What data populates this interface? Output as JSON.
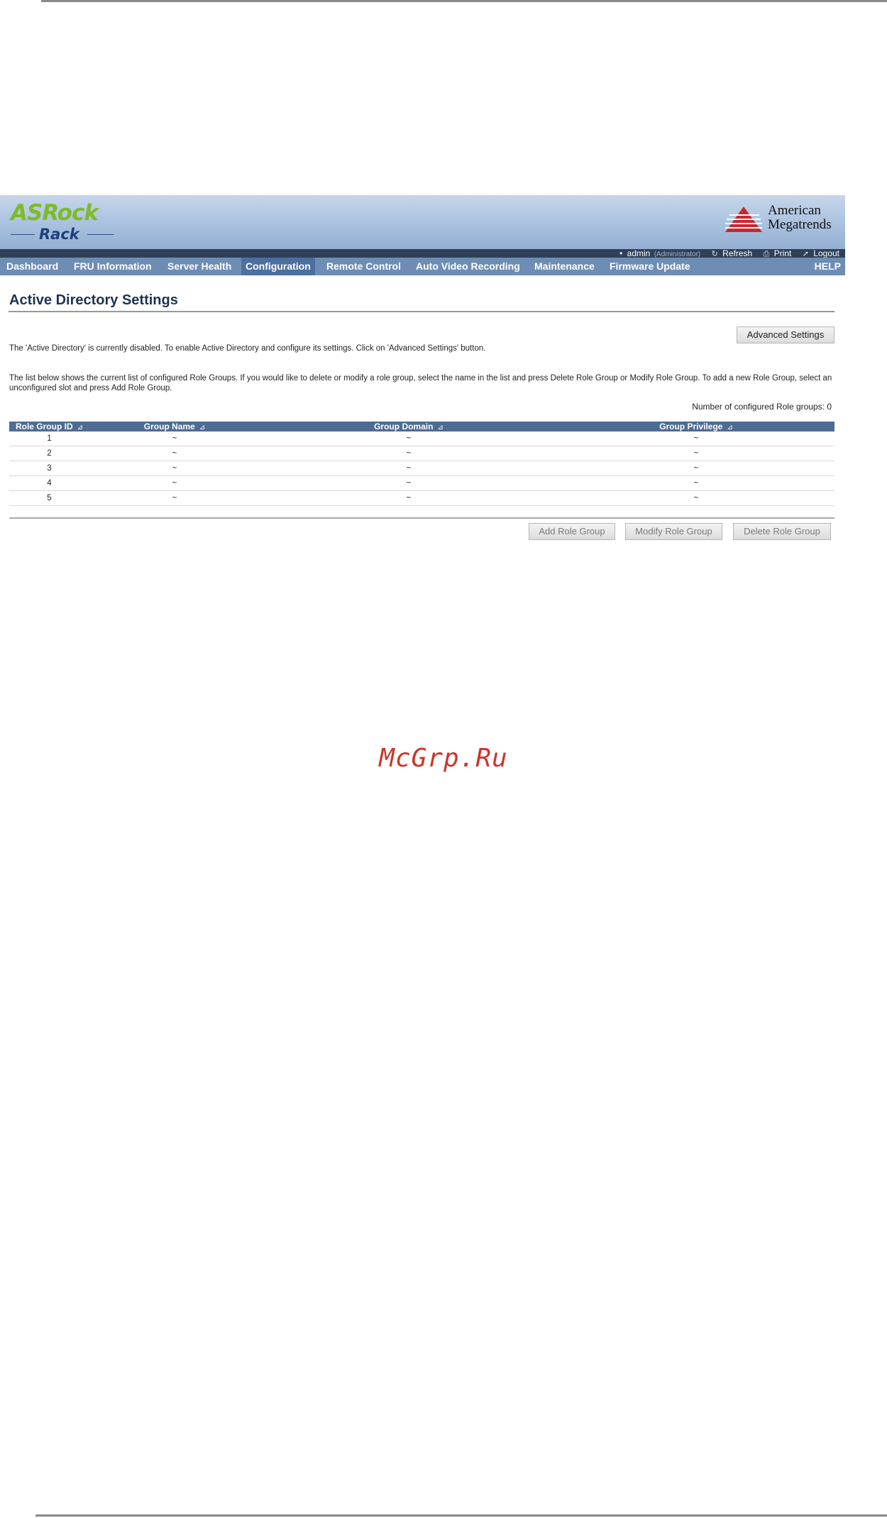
{
  "brand": {
    "logo_top": "ASRock",
    "logo_bottom": "Rack",
    "vendor_line1": "American",
    "vendor_line2": "Megatrends"
  },
  "user_bar": {
    "user": "admin",
    "role": "(Administrator)",
    "refresh": "Refresh",
    "print": "Print",
    "logout": "Logout"
  },
  "nav": {
    "items": [
      {
        "label": "Dashboard"
      },
      {
        "label": "FRU Information"
      },
      {
        "label": "Server Health"
      },
      {
        "label": "Configuration",
        "active": true
      },
      {
        "label": "Remote Control"
      },
      {
        "label": "Auto Video Recording"
      },
      {
        "label": "Maintenance"
      },
      {
        "label": "Firmware Update"
      }
    ],
    "help": "HELP"
  },
  "page": {
    "title": "Active Directory Settings",
    "advanced_button": "Advanced Settings",
    "status_text": "The 'Active Directory' is currently disabled. To enable Active Directory and configure its settings. Click on 'Advanced Settings' button.",
    "info_text": "The list below shows the current list of configured Role Groups. If you would like to delete or modify a role group, select the name in the list and press Delete Role Group or Modify Role Group. To add a new Role Group, select an unconfigured slot and press Add Role Group.",
    "count_text": "Number of configured Role groups: 0"
  },
  "table": {
    "columns": [
      "Role Group ID",
      "Group Name",
      "Group Domain",
      "Group Privilege"
    ],
    "rows": [
      [
        "1",
        "~",
        "~",
        "~"
      ],
      [
        "2",
        "~",
        "~",
        "~"
      ],
      [
        "3",
        "~",
        "~",
        "~"
      ],
      [
        "4",
        "~",
        "~",
        "~"
      ],
      [
        "5",
        "~",
        "~",
        "~"
      ]
    ]
  },
  "actions": {
    "add": "Add Role Group",
    "modify": "Modify Role Group",
    "delete": "Delete Role Group"
  },
  "watermark": "McGrp.Ru",
  "colors": {
    "header_bg": "#a9c1df",
    "nav_bg": "#6e8db4",
    "nav_active": "#4c6f9f",
    "table_header": "#4e6c93",
    "logo_green": "#7dbb28",
    "logo_blue": "#1f3f7a",
    "ami_red": "#c8282e",
    "watermark": "#c9362b"
  }
}
